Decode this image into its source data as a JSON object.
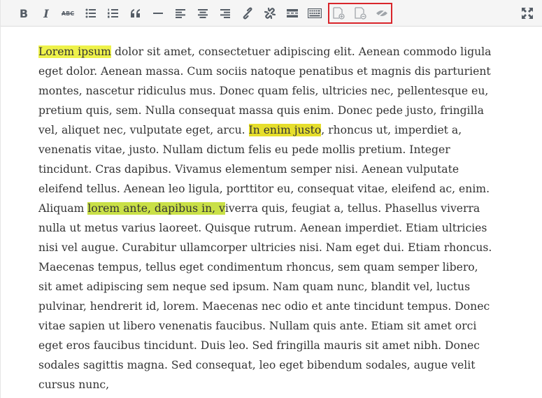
{
  "toolbar": {
    "buttons": [
      {
        "name": "bold",
        "label": "B",
        "icon": "bold-icon"
      },
      {
        "name": "italic",
        "label": "I",
        "icon": "italic-icon"
      },
      {
        "name": "strikethrough",
        "label": "ABC",
        "icon": "strikethrough-icon"
      },
      {
        "name": "bulleted-list",
        "icon": "bulleted-list-icon"
      },
      {
        "name": "numbered-list",
        "icon": "numbered-list-icon"
      },
      {
        "name": "blockquote",
        "label": "“",
        "icon": "blockquote-icon"
      },
      {
        "name": "horizontal-line",
        "icon": "horizontal-line-icon"
      },
      {
        "name": "align-left",
        "icon": "align-left-icon"
      },
      {
        "name": "align-center",
        "icon": "align-center-icon"
      },
      {
        "name": "align-right",
        "icon": "align-right-icon"
      },
      {
        "name": "insert-link",
        "icon": "link-icon"
      },
      {
        "name": "remove-link",
        "icon": "unlink-icon"
      },
      {
        "name": "read-more",
        "icon": "read-more-icon"
      },
      {
        "name": "toolbar-toggle",
        "icon": "keyboard-icon"
      },
      {
        "name": "add-note",
        "icon": "add-note-icon"
      },
      {
        "name": "remove-note",
        "icon": "remove-note-icon"
      },
      {
        "name": "toggle-visibility",
        "icon": "hide-eye-icon"
      },
      {
        "name": "fullscreen",
        "icon": "fullscreen-icon"
      }
    ],
    "highlight_color": "#d9252b"
  },
  "colors": {
    "highlight_1": "#eef24a",
    "highlight_2": "#e6de2c",
    "highlight_3": "#c9e047",
    "text": "#333333"
  },
  "content": {
    "lines": [
      [
        "",
        "Lorem ipsum",
        " dolor sit amet, consectetuer adipiscing elit. Aenean commodo ligula"
      ],
      [
        "eget dolor. Aenean massa. Cum sociis natoque penatibus et magnis dis parturient",
        "",
        ""
      ],
      [
        "montes, nascetur ridiculus mus. Donec quam felis, ultricies nec, pellentesque eu,",
        "",
        ""
      ],
      [
        "pretium quis, sem. Nulla consequat massa quis enim. Donec pede justo, fringilla",
        "",
        ""
      ],
      [
        "vel, aliquet nec, vulputate eget, arcu. ",
        "In enim justo",
        ", rhoncus ut, imperdiet a,"
      ],
      [
        "venenatis vitae, justo. Nullam dictum felis eu pede mollis pretium. Integer",
        "",
        ""
      ],
      [
        "tincidunt. Cras dapibus. Vivamus elementum semper nisi. Aenean vulputate",
        "",
        ""
      ],
      [
        "eleifend tellus. Aenean leo ligula, porttitor eu, consequat vitae, eleifend ac, enim.",
        "",
        ""
      ],
      [
        "Aliquam ",
        "lorem ante, dapibus in, v",
        "iverra quis, feugiat a, tellus. Phasellus viverra"
      ],
      [
        "nulla ut metus varius laoreet. Quisque rutrum. Aenean imperdiet. Etiam ultricies",
        "",
        ""
      ],
      [
        "nisi vel augue. Curabitur ullamcorper ultricies nisi. Nam eget dui. Etiam rhoncus.",
        "",
        ""
      ],
      [
        "Maecenas tempus, tellus eget condimentum rhoncus, sem quam semper libero,",
        "",
        ""
      ],
      [
        "sit amet adipiscing sem neque sed ipsum. Nam quam nunc, blandit vel, luctus",
        "",
        ""
      ],
      [
        "pulvinar, hendrerit id, lorem. Maecenas nec odio et ante tincidunt tempus. Donec",
        "",
        ""
      ],
      [
        "vitae sapien ut libero venenatis faucibus. Nullam quis ante. Etiam sit amet orci",
        "",
        ""
      ],
      [
        "eget eros faucibus tincidunt. Duis leo. Sed fringilla mauris sit amet nibh. Donec",
        "",
        ""
      ],
      [
        "sodales sagittis magna. Sed consequat, leo eget bibendum sodales, augue velit",
        "",
        ""
      ],
      [
        "cursus nunc,",
        "",
        ""
      ]
    ]
  }
}
